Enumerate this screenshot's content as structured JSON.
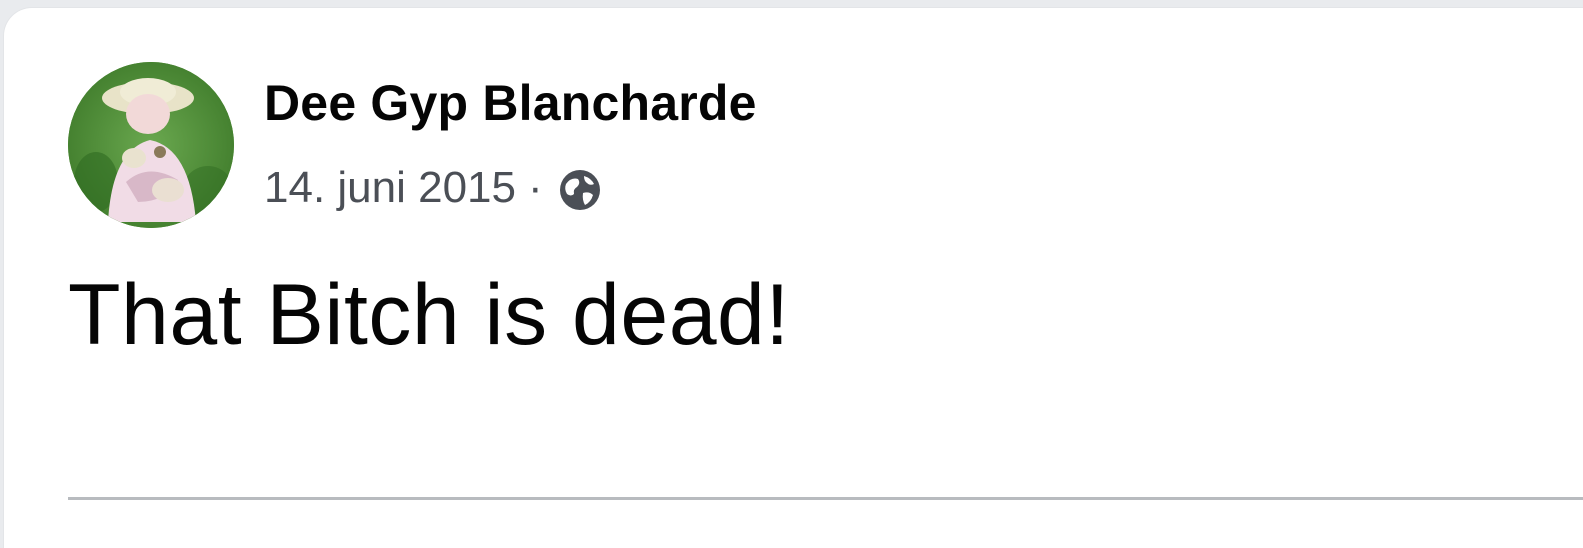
{
  "post": {
    "author_name": "Dee Gyp Blancharde",
    "date": "14. juni 2015",
    "separator": "·",
    "audience_icon": "globe-icon",
    "text": "That Bitch is dead!"
  },
  "colors": {
    "background": "#e9ebee",
    "card": "#ffffff",
    "primary_text": "#050505",
    "secondary_text": "#4b4f56",
    "divider": "#b8bbbf"
  }
}
